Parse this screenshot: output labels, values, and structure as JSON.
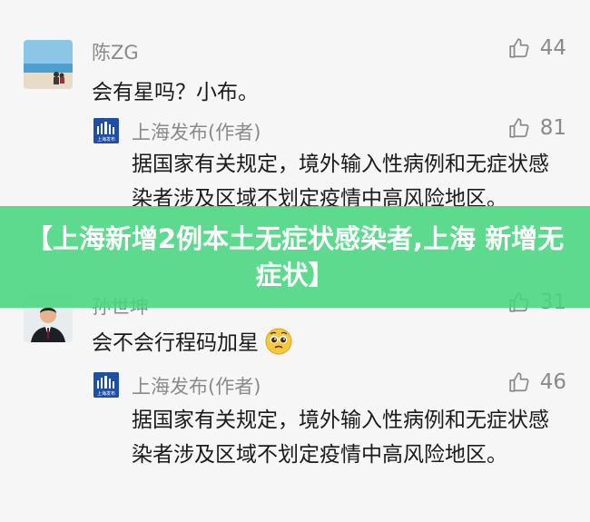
{
  "comments": [
    {
      "name": "陈ZG",
      "text": "会有星吗？小布。",
      "likes": "44",
      "reply": {
        "author": "上海发布(作者)",
        "logo_text": "上海发布",
        "text": "据国家有关规定，境外输入性病例和无症状感染者涉及区域不划定疫情中高风险地区。",
        "likes": "81"
      }
    },
    {
      "name": "孙世坤",
      "text": "会不会行程码加星",
      "emoji": "pleading-face-icon",
      "likes": "31",
      "reply": {
        "author": "上海发布(作者)",
        "logo_text": "上海发布",
        "text": "据国家有关规定，境外输入性病例和无症状感染者涉及区域不划定疫情中高风险地区。",
        "likes": "46"
      }
    }
  ],
  "banner": {
    "text": "【上海新增2例本土无症状感染者,上海 新增无症状】",
    "color": "#48d680"
  },
  "colors": {
    "background": "#f6f6f6",
    "muted_text": "#8a8a8a",
    "logo_blue": "#1f4fa3"
  }
}
